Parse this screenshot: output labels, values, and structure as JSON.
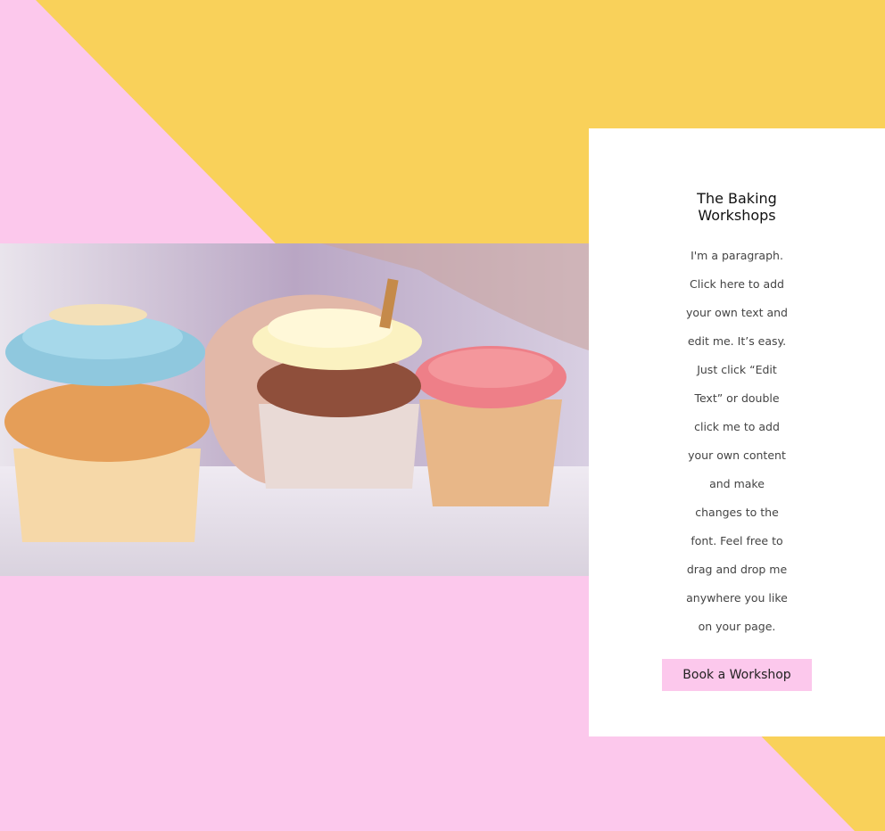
{
  "colors": {
    "pink": "#FCC8EC",
    "yellow": "#F9D15A",
    "card_background": "#FFFFFF"
  },
  "hero": {
    "image_subject": "cupcakes"
  },
  "card": {
    "title": "The Baking\nWorkshops",
    "paragraph": "I'm a paragraph.\nClick here to add\nyour own text and\nedit me. It’s easy.\nJust click “Edit\nText” or double\nclick me to add\nyour own content\nand make\nchanges to the\nfont. Feel free to\ndrag and drop me\nanywhere you like\non your page.",
    "button_label": "Book a Workshop"
  }
}
